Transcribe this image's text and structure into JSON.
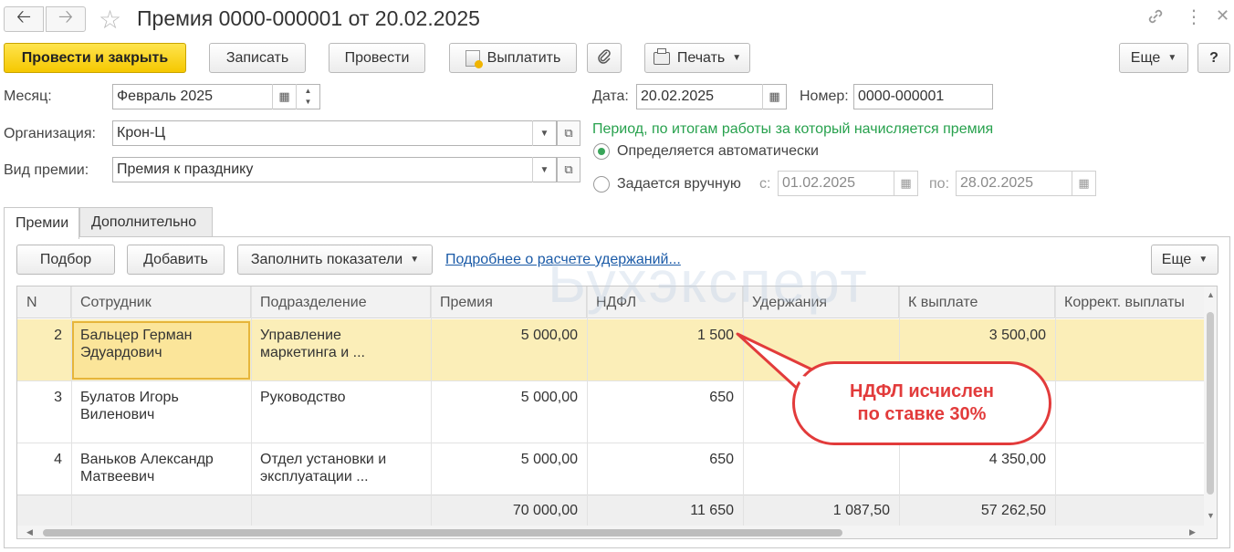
{
  "window": {
    "title": "Премия 0000-000001 от 20.02.2025"
  },
  "toolbar": {
    "post_close": "Провести и закрыть",
    "save": "Записать",
    "post": "Провести",
    "pay": "Выплатить",
    "print": "Печать",
    "more": "Еще",
    "help": "?"
  },
  "form": {
    "month_label": "Месяц:",
    "month_value": "Февраль 2025",
    "org_label": "Организация:",
    "org_value": "Крон-Ц",
    "bonus_type_label": "Вид премии:",
    "bonus_type_value": "Премия к празднику",
    "date_label": "Дата:",
    "date_value": "20.02.2025",
    "number_label": "Номер:",
    "number_value": "0000-000001",
    "period_hint": "Период, по итогам работы за который начисляется премия",
    "radio_auto": "Определяется автоматически",
    "radio_manual": "Задается вручную",
    "from_label": "с:",
    "from_value": "01.02.2025",
    "to_label": "по:",
    "to_value": "28.02.2025"
  },
  "tabs": [
    {
      "label": "Премии",
      "active": true
    },
    {
      "label": "Дополнительно",
      "active": false
    }
  ],
  "table_toolbar": {
    "pick": "Подбор",
    "add": "Добавить",
    "fill": "Заполнить показатели",
    "details_link": "Подробнее о расчете удержаний...",
    "more": "Еще"
  },
  "table": {
    "columns": [
      "N",
      "Сотрудник",
      "Подразделение",
      "Премия",
      "НДФЛ",
      "Удержания",
      "К выплате",
      "Коррект. выплаты"
    ],
    "rows": [
      {
        "n": "2",
        "emp1": "Бальцер Герман",
        "emp2": "Эдуардович",
        "dep1": "Управление",
        "dep2": "маркетинга и ...",
        "bonus": "5 000,00",
        "ndfl": "1 500",
        "hold": "",
        "pay": "3 500,00",
        "corr": ""
      },
      {
        "n": "3",
        "emp1": "Булатов Игорь",
        "emp2": "Виленович",
        "dep1": "Руководство",
        "dep2": "",
        "bonus": "5 000,00",
        "ndfl": "650",
        "hold": "",
        "pay": "",
        "corr": ""
      },
      {
        "n": "4",
        "emp1": "Ваньков Александр",
        "emp2": "Матвеевич",
        "dep1": "Отдел установки и",
        "dep2": "эксплуатации ...",
        "bonus": "5 000,00",
        "ndfl": "650",
        "hold": "",
        "pay": "4 350,00",
        "corr": ""
      }
    ],
    "totals": {
      "bonus": "70 000,00",
      "ndfl": "11 650",
      "hold": "1 087,50",
      "pay": "57 262,50"
    }
  },
  "watermark": "Бухэксперт",
  "callout": {
    "line1": "НДФЛ исчислен",
    "line2": "по ставке 30%"
  },
  "colors": {
    "primary_button": "#f5c800",
    "selected_row": "#fbeeb8",
    "callout": "#e23b3b",
    "hint_green": "#27a14d",
    "link": "#1a5aa7"
  }
}
